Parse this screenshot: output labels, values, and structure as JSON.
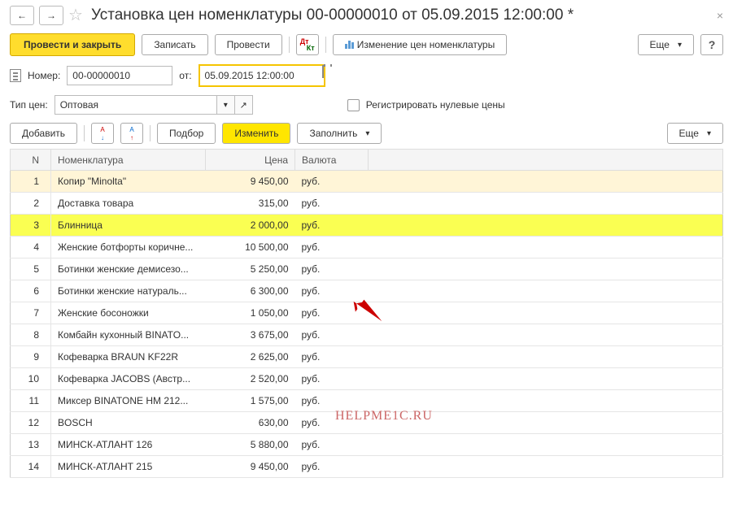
{
  "title": "Установка цен номенклатуры 00-00000010 от 05.09.2015 12:00:00 *",
  "buttons": {
    "primary": "Провести и закрыть",
    "write": "Записать",
    "post": "Провести",
    "report": "Изменение цен номенклатуры",
    "more": "Еще",
    "add": "Добавить",
    "pick": "Подбор",
    "change": "Изменить",
    "fill": "Заполнить"
  },
  "labels": {
    "number": "Номер:",
    "from": "от:",
    "priceType": "Тип цен:",
    "regZero": "Регистрировать нулевые цены",
    "help": "?"
  },
  "fields": {
    "number": "00-00000010",
    "date": "05.09.2015 12:00:00",
    "priceType": "Оптовая"
  },
  "table": {
    "columns": {
      "n": "N",
      "name": "Номенклатура",
      "price": "Цена",
      "currency": "Валюта"
    },
    "rows": [
      {
        "n": "1",
        "name": "Копир \"Minolta\"",
        "price": "9 450,00",
        "currency": "руб."
      },
      {
        "n": "2",
        "name": "Доставка товара",
        "price": "315,00",
        "currency": "руб."
      },
      {
        "n": "3",
        "name": "Блинница",
        "price": "2 000,00",
        "currency": "руб."
      },
      {
        "n": "4",
        "name": "Женские ботфорты коричне...",
        "price": "10 500,00",
        "currency": "руб."
      },
      {
        "n": "5",
        "name": "Ботинки женские демисезо...",
        "price": "5 250,00",
        "currency": "руб."
      },
      {
        "n": "6",
        "name": "Ботинки женские натураль...",
        "price": "6 300,00",
        "currency": "руб."
      },
      {
        "n": "7",
        "name": "Женские босоножки",
        "price": "1 050,00",
        "currency": "руб."
      },
      {
        "n": "8",
        "name": "Комбайн кухонный BINATO...",
        "price": "3 675,00",
        "currency": "руб."
      },
      {
        "n": "9",
        "name": "Кофеварка BRAUN KF22R",
        "price": "2 625,00",
        "currency": "руб."
      },
      {
        "n": "10",
        "name": "Кофеварка JACOBS (Австр...",
        "price": "2 520,00",
        "currency": "руб."
      },
      {
        "n": "11",
        "name": "Миксер BINATONE HM 212...",
        "price": "1 575,00",
        "currency": "руб."
      },
      {
        "n": "12",
        "name": "BOSCH",
        "price": "630,00",
        "currency": "руб."
      },
      {
        "n": "13",
        "name": "МИНСК-АТЛАНТ 126",
        "price": "5 880,00",
        "currency": "руб."
      },
      {
        "n": "14",
        "name": "МИНСК-АТЛАНТ 215",
        "price": "9 450,00",
        "currency": "руб."
      }
    ]
  },
  "watermark": "HELPME1C.RU",
  "highlight_rows": {
    "selected": 0,
    "highlighted": 2
  }
}
